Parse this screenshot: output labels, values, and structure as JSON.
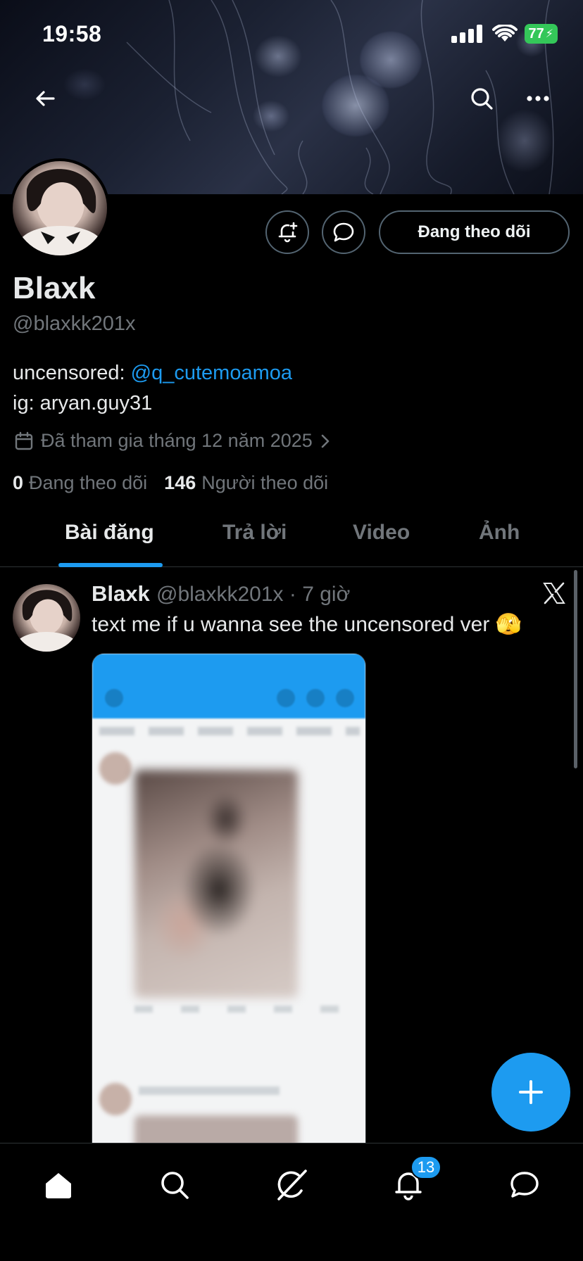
{
  "status_bar": {
    "time": "19:58",
    "battery": "77"
  },
  "profile": {
    "name": "Blaxk",
    "handle": "@blaxkk201x",
    "bio_prefix": "uncensored: ",
    "bio_mention": "@q_cutemoamoa",
    "bio_line2": "ig: aryan.guy31",
    "joined": "Đã tham gia tháng 12 năm 2025",
    "following_count": "0",
    "following_label": "Đang theo dõi",
    "followers_count": "146",
    "followers_label": "Người theo dõi",
    "follow_button": "Đang theo dõi"
  },
  "tabs": [
    {
      "label": "Bài đăng",
      "active": true
    },
    {
      "label": "Trả lời",
      "active": false
    },
    {
      "label": "Video",
      "active": false
    },
    {
      "label": "Ảnh",
      "active": false
    }
  ],
  "post": {
    "name": "Blaxk",
    "meta": "@blaxkk201x · 7 giờ",
    "text": "text me if u wanna see the uncensored ver 🫣"
  },
  "bottom_nav": {
    "items": [
      "home-icon",
      "search-icon",
      "grok-icon",
      "notifications-icon",
      "messages-icon"
    ],
    "notification_badge": "13"
  },
  "colors": {
    "accent": "#1d9bf0",
    "secondary_text": "#71767b",
    "border": "#2f3336"
  }
}
